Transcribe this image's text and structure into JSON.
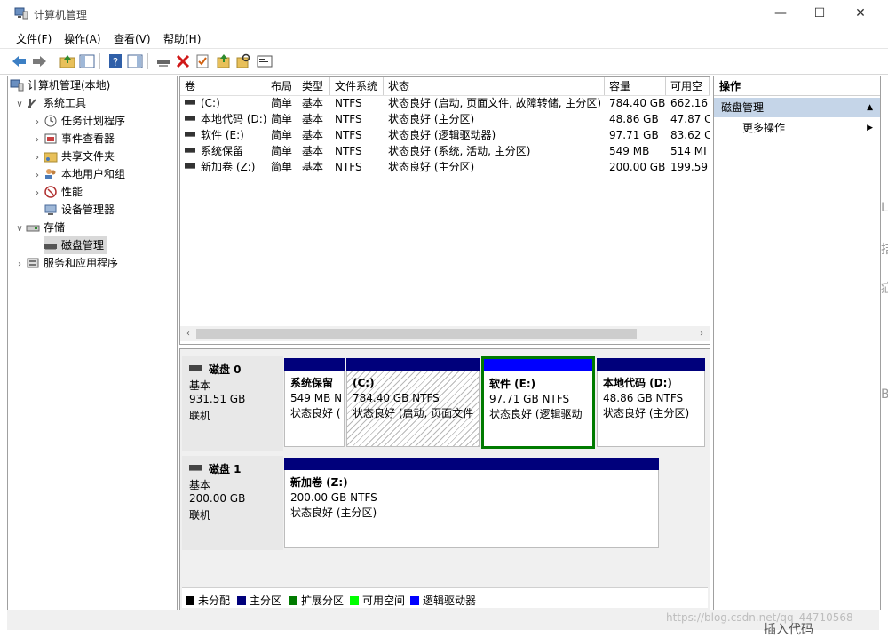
{
  "window": {
    "title": "计算机管理",
    "minimize": "—",
    "maximize": "☐",
    "close": "✕"
  },
  "menu": [
    "文件(F)",
    "操作(A)",
    "查看(V)",
    "帮助(H)"
  ],
  "tree": {
    "root": "计算机管理(本地)",
    "system_tools": "系统工具",
    "task_scheduler": "任务计划程序",
    "event_viewer": "事件查看器",
    "shared_folders": "共享文件夹",
    "local_users": "本地用户和组",
    "performance": "性能",
    "device_manager": "设备管理器",
    "storage": "存储",
    "disk_management": "磁盘管理",
    "services": "服务和应用程序"
  },
  "list": {
    "columns": [
      "卷",
      "布局",
      "类型",
      "文件系统",
      "状态",
      "容量",
      "可用空"
    ],
    "rows": [
      [
        "(C:)",
        "简单",
        "基本",
        "NTFS",
        "状态良好 (启动, 页面文件, 故障转储, 主分区)",
        "784.40 GB",
        "662.16"
      ],
      [
        "本地代码 (D:)",
        "简单",
        "基本",
        "NTFS",
        "状态良好 (主分区)",
        "48.86 GB",
        "47.87 C"
      ],
      [
        "软件 (E:)",
        "简单",
        "基本",
        "NTFS",
        "状态良好 (逻辑驱动器)",
        "97.71 GB",
        "83.62 C"
      ],
      [
        "系统保留",
        "简单",
        "基本",
        "NTFS",
        "状态良好 (系统, 活动, 主分区)",
        "549 MB",
        "514 MI"
      ],
      [
        "新加卷 (Z:)",
        "简单",
        "基本",
        "NTFS",
        "状态良好 (主分区)",
        "200.00 GB",
        "199.59"
      ]
    ]
  },
  "disks": [
    {
      "name": "磁盘 0",
      "type": "基本",
      "size": "931.51 GB",
      "state": "联机",
      "partitions": [
        {
          "title": "系统保留",
          "size": "549 MB N",
          "status": "状态良好 ("
        },
        {
          "title": "(C:)",
          "size": "784.40 GB NTFS",
          "status": "状态良好 (启动, 页面文件"
        },
        {
          "title": "软件  (E:)",
          "size": "97.71 GB NTFS",
          "status": "状态良好 (逻辑驱动"
        },
        {
          "title": "本地代码  (D:)",
          "size": "48.86 GB NTFS",
          "status": "状态良好 (主分区)"
        }
      ]
    },
    {
      "name": "磁盘 1",
      "type": "基本",
      "size": "200.00 GB",
      "state": "联机",
      "partitions": [
        {
          "title": "新加卷  (Z:)",
          "size": "200.00 GB NTFS",
          "status": "状态良好 (主分区)"
        }
      ]
    }
  ],
  "legend": [
    {
      "label": "未分配",
      "color": "#000000"
    },
    {
      "label": "主分区",
      "color": "#00007b"
    },
    {
      "label": "扩展分区",
      "color": "#007b00"
    },
    {
      "label": "可用空间",
      "color": "#00ff00"
    },
    {
      "label": "逻辑驱动器",
      "color": "#0000ff"
    }
  ],
  "actions": {
    "header": "操作",
    "section": "磁盘管理",
    "more": "更多操作"
  },
  "colors": {
    "primary_bar": "#00007b",
    "logical_bar": "#0000ff",
    "selected_border": "#007b00"
  },
  "watermark": "https://blog.csdn.net/qq_44710568",
  "background_fragments": [
    "L",
    "拮",
    "疝",
    "B",
    "插入代码"
  ]
}
